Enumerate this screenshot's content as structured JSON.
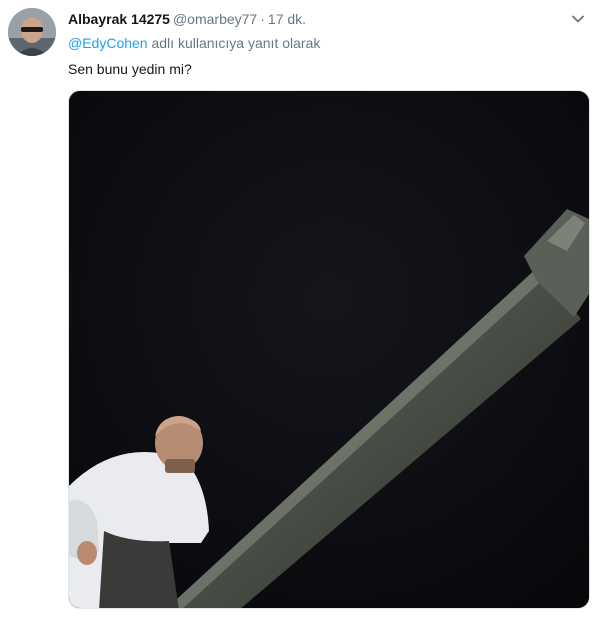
{
  "tweet": {
    "display_name": "Albayrak 14275",
    "handle": "@omarbey77",
    "separator": "·",
    "time": "17 dk.",
    "reply_mention": "@EdyCohen",
    "reply_suffix": "adlı kullanıcıya yanıt olarak",
    "text": "Sen bunu yedin mi?"
  },
  "icons": {
    "more": "chevron-down-icon",
    "avatar": "profile-photo",
    "media": "night-photo-man-on-cannon-barrel"
  },
  "colors": {
    "link": "#1da1f2",
    "secondary_text": "#657786",
    "primary_text": "#14171a",
    "photo_background": "#0b0b0e"
  }
}
